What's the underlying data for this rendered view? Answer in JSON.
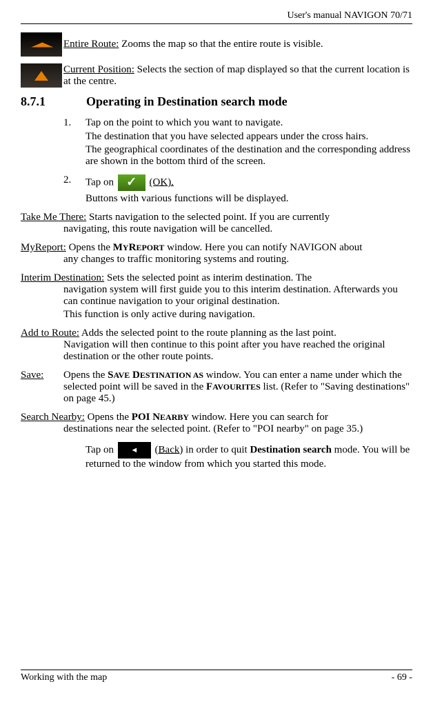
{
  "header": {
    "title": "User's manual NAVIGON 70/71"
  },
  "entireRoute": {
    "label": "Entire Route:",
    "text": " Zooms the map so that the entire route is visible."
  },
  "currentPosition": {
    "label": "Current Position:",
    "text": " Selects the section of map displayed so that the current location is at the centre."
  },
  "section": {
    "number": "8.7.1",
    "title": "Operating in Destination search mode"
  },
  "step1": {
    "num": "1.",
    "text": "Tap on the point to which you want to navigate.",
    "sub1": "The destination that you have selected appears under the cross hairs.",
    "sub2": "The geographical coordinates of the destination and the corresponding address are shown in the bottom third of the screen."
  },
  "step2": {
    "num": "2.",
    "prefix": "Tap on ",
    "okLabel": " (OK).",
    "sub": "Buttons with various functions will be displayed."
  },
  "takeMeThere": {
    "label": "Take Me There:",
    "text": " Starts navigation to the selected point. If you are currently navigating, this route navigation will be cancelled."
  },
  "myReport": {
    "label": "MyReport:",
    "pre": " Opens the ",
    "win": "MyReport",
    "post": " window. Here you can notify NAVIGON about any changes to traffic monitoring systems and routing."
  },
  "interim": {
    "label": "Interim Destination:",
    "text": " Sets the selected point as interim destination. The navigation system will first guide you to this interim destination. Afterwards you can continue navigation to your original destination.",
    "note": "This function is only active during navigation."
  },
  "addRoute": {
    "label": "Add to Route:",
    "text": " Adds the selected point to the route planning as the last point. Navigation will then continue to this point after you have reached the original destination or the other route points."
  },
  "save": {
    "label": "Save:",
    "pre": "Opens the ",
    "win": "Save Destination as",
    "mid": " window. You can enter a name under which the selected point will be saved in the ",
    "fav": "Favourites",
    "post": " list. (Refer to \"Saving destinations\" on page 45.)"
  },
  "searchNearby": {
    "label": "Search Nearby:",
    "pre": " Opens the ",
    "win": "POI Nearby",
    "post": " window. Here you can search for destinations near the selected point. (Refer to \"POI nearby\" on page 35.)"
  },
  "backStep": {
    "pre": "Tap on ",
    "back": "Back",
    "mid": ") in order to quit ",
    "mode": "Destination search",
    "post": " mode. You will be returned to the window from which you started this mode."
  },
  "footer": {
    "left": "Working with the map",
    "right": "- 69 -"
  }
}
